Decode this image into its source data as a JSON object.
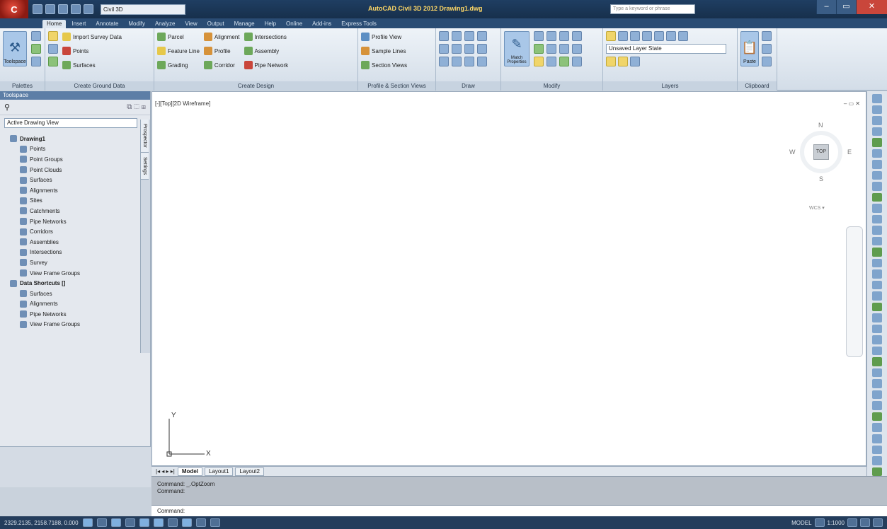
{
  "titlebar": {
    "app_letter": "C",
    "workspace": "Civil 3D",
    "title": "AutoCAD Civil 3D 2012  Drawing1.dwg",
    "search_placeholder": "Type a keyword or phrase"
  },
  "tabs": [
    "Home",
    "Insert",
    "Annotate",
    "Modify",
    "Analyze",
    "View",
    "Output",
    "Manage",
    "Help",
    "Online",
    "Add-ins",
    "Express Tools"
  ],
  "ribbon": {
    "toolspace_label": "Toolspace",
    "palettes_title": "Palettes",
    "ground_title": "Create Ground Data",
    "ground_cmds": [
      "Import Survey Data",
      "Points",
      "Surfaces"
    ],
    "design_title": "Create Design",
    "design_col1": [
      "Parcel",
      "Feature Line",
      "Grading"
    ],
    "design_col2": [
      "Alignment",
      "Profile",
      "Corridor"
    ],
    "design_col3": [
      "Intersections",
      "Assembly",
      "Pipe Network"
    ],
    "profile_title": "Profile & Section Views",
    "profile_cmds": [
      "Profile View",
      "Sample Lines",
      "Section Views"
    ],
    "draw_title": "Draw",
    "modify_title": "Modify",
    "match_label": "Match Properties",
    "layers_title": "Layers",
    "layer_state": "Unsaved Layer State",
    "clipboard_title": "Clipboard",
    "paste_label": "Paste"
  },
  "palette": {
    "header": "Toolspace",
    "view_select": "Active Drawing View",
    "tree": [
      {
        "label": "Drawing1",
        "level": 0
      },
      {
        "label": "Points",
        "level": 1
      },
      {
        "label": "Point Groups",
        "level": 1
      },
      {
        "label": "Point Clouds",
        "level": 1
      },
      {
        "label": "Surfaces",
        "level": 1
      },
      {
        "label": "Alignments",
        "level": 1
      },
      {
        "label": "Sites",
        "level": 1
      },
      {
        "label": "Catchments",
        "level": 1
      },
      {
        "label": "Pipe Networks",
        "level": 1
      },
      {
        "label": "Corridors",
        "level": 1
      },
      {
        "label": "Assemblies",
        "level": 1
      },
      {
        "label": "Intersections",
        "level": 1
      },
      {
        "label": "Survey",
        "level": 1
      },
      {
        "label": "View Frame Groups",
        "level": 1
      },
      {
        "label": "Data Shortcuts []",
        "level": 0
      },
      {
        "label": "Surfaces",
        "level": 1
      },
      {
        "label": "Alignments",
        "level": 1
      },
      {
        "label": "Pipe Networks",
        "level": 1
      },
      {
        "label": "View Frame Groups",
        "level": 1
      }
    ],
    "vtabs": [
      "Prospector",
      "Settings"
    ]
  },
  "viewport": {
    "label": "[-][Top][2D Wireframe]",
    "controls": "– ▭ ✕",
    "cube_top": "TOP",
    "dir_n": "N",
    "dir_s": "S",
    "dir_e": "E",
    "dir_w": "W",
    "wcs": "WCS ▾",
    "ucs_x": "X",
    "ucs_y": "Y"
  },
  "layout_tabs": [
    "Model",
    "Layout1",
    "Layout2"
  ],
  "layout_nav": "|◂ ◂ ▸ ▸|",
  "command": {
    "history_1": "Command:  _.OptZoom",
    "history_2": "Command:",
    "prompt": "Command:"
  },
  "statusbar": {
    "coords": "2329.2135, 2158.7188, 0.000",
    "model_label": "MODEL",
    "scale": "1:1000"
  }
}
